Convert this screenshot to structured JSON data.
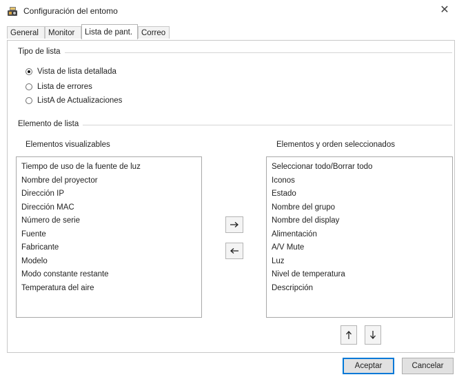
{
  "window": {
    "title": "Configuración del entomo"
  },
  "tabs": [
    {
      "label": "General"
    },
    {
      "label": "Monitor"
    },
    {
      "label": "Lista de pant."
    },
    {
      "label": "Correo"
    }
  ],
  "list_type": {
    "label": "Tipo de lista",
    "options": [
      {
        "label": "Vista de lista detallada",
        "checked": true
      },
      {
        "label": "Lista de errores",
        "checked": false
      },
      {
        "label": "ListA de Actualizaciones",
        "checked": false
      }
    ]
  },
  "list_element": {
    "label": "Elemento de lista"
  },
  "available": {
    "heading": "Elementos visualizables",
    "items": [
      "Tiempo de uso de la fuente de luz",
      "Nombre del proyector",
      "Dirección IP",
      "Dirección MAC",
      "Número de serie",
      "Fuente",
      "Fabricante",
      "Modelo",
      "Modo constante restante",
      "Temperatura del aire"
    ]
  },
  "selected": {
    "heading": "Elementos y orden seleccionados",
    "items": [
      "Seleccionar todo/Borrar todo",
      "Iconos",
      "Estado",
      "Nombre del grupo",
      "Nombre del display",
      "Alimentación",
      "A/V Mute",
      "Luz",
      "Nivel de temperatura",
      "Descripción"
    ]
  },
  "buttons": {
    "ok": "Aceptar",
    "cancel": "Cancelar"
  },
  "icons": {
    "close": "close-icon",
    "app": "projector-app-icon",
    "add": "arrow-right-icon",
    "remove": "arrow-left-icon",
    "up": "arrow-up-icon",
    "down": "arrow-down-icon"
  }
}
